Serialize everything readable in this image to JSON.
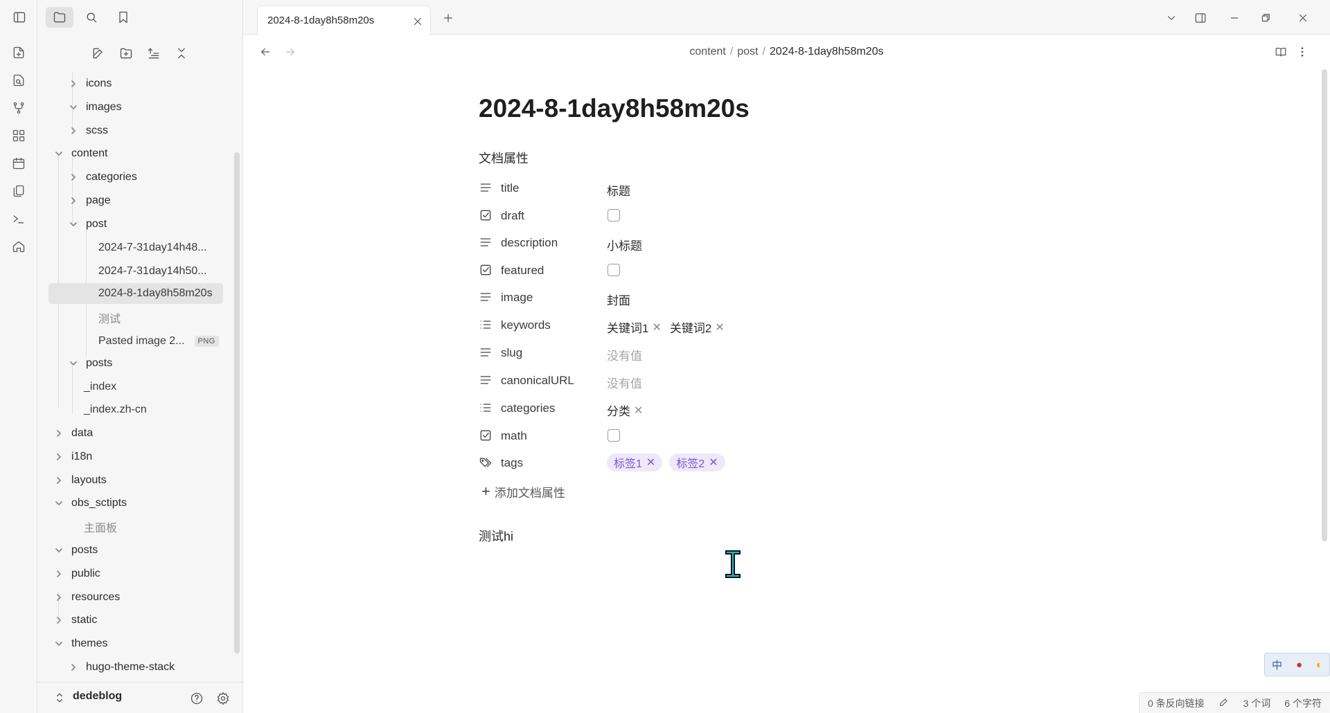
{
  "sidebar": {
    "vault_name": "dedeblog",
    "tree": [
      {
        "label": "icons",
        "state": "collapsed"
      },
      {
        "label": "images",
        "state": "expanded"
      },
      {
        "label": "scss",
        "state": "collapsed"
      },
      {
        "label": "content",
        "state": "expanded"
      },
      {
        "label": "categories",
        "state": "collapsed"
      },
      {
        "label": "page",
        "state": "collapsed"
      },
      {
        "label": "post",
        "state": "expanded"
      },
      {
        "label": "2024-7-31day14h48..."
      },
      {
        "label": "2024-7-31day14h50..."
      },
      {
        "label": "2024-8-1day8h58m20s",
        "selected": true
      },
      {
        "label": "测试"
      },
      {
        "label": "Pasted image 2...",
        "badge": "PNG"
      },
      {
        "label": "posts",
        "state": "expanded"
      },
      {
        "label": "_index"
      },
      {
        "label": "_index.zh-cn"
      },
      {
        "label": "data",
        "state": "collapsed"
      },
      {
        "label": "i18n",
        "state": "collapsed"
      },
      {
        "label": "layouts",
        "state": "collapsed"
      },
      {
        "label": "obs_sctipts",
        "state": "expanded"
      },
      {
        "label": "主面板"
      },
      {
        "label": "posts",
        "state": "expanded"
      },
      {
        "label": "public",
        "state": "collapsed"
      },
      {
        "label": "resources",
        "state": "collapsed"
      },
      {
        "label": "static",
        "state": "collapsed"
      },
      {
        "label": "themes",
        "state": "expanded"
      },
      {
        "label": "hugo-theme-stack",
        "state": "collapsed"
      }
    ]
  },
  "tab": {
    "title": "2024-8-1day8h58m20s"
  },
  "breadcrumb": {
    "part1": "content",
    "part2": "post",
    "current": "2024-8-1day8h58m20s",
    "sep": "/"
  },
  "document": {
    "title": "2024-8-1day8h58m20s",
    "properties_heading": "文档属性",
    "properties": {
      "title": {
        "key": "title",
        "value": "标题"
      },
      "draft": {
        "key": "draft",
        "checked": false
      },
      "description": {
        "key": "description",
        "value": "小标题"
      },
      "featured": {
        "key": "featured",
        "checked": false
      },
      "image": {
        "key": "image",
        "value": "封面"
      },
      "keywords": {
        "key": "keywords",
        "items": [
          "关键词1",
          "关键词2"
        ]
      },
      "slug": {
        "key": "slug",
        "empty_text": "没有值"
      },
      "canonicalURL": {
        "key": "canonicalURL",
        "empty_text": "没有值"
      },
      "categories": {
        "key": "categories",
        "items": [
          "分类"
        ]
      },
      "math": {
        "key": "math",
        "checked": false
      },
      "tags": {
        "key": "tags",
        "items": [
          "标签1",
          "标签2"
        ]
      }
    },
    "add_property": "添加文档属性",
    "body": "测试hi"
  },
  "ime": {
    "mode": "中"
  },
  "status": {
    "backlinks": "0 条反向链接",
    "words": "3 个词",
    "chars": "6 个字符"
  },
  "colors": {
    "tag_bg": "#efe8fb",
    "tag_fg": "#7d57c7",
    "selected_bg": "#e4e4e4",
    "sidebar_bg": "#f6f6f6"
  }
}
